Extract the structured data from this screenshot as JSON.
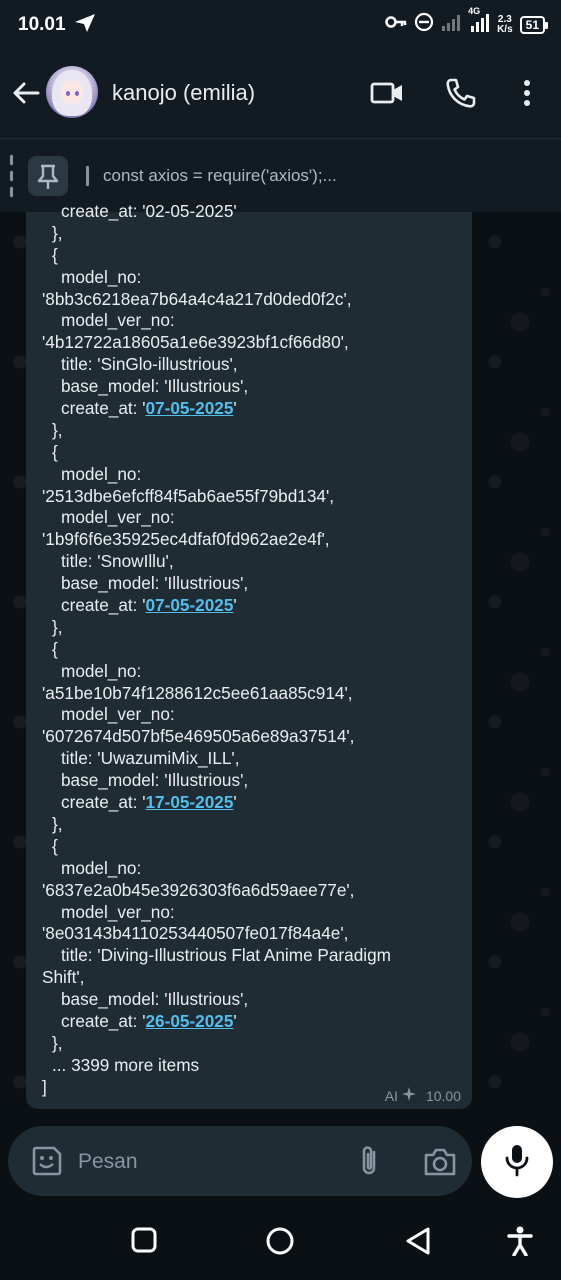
{
  "status_bar": {
    "time": "10.01",
    "network_type": "4G",
    "speed_value": "2.3",
    "speed_unit": "K/s",
    "battery": "51"
  },
  "header": {
    "contact_name": "kanojo (emilia)"
  },
  "pinned": {
    "preview": "const axios = require('axios');..."
  },
  "message": {
    "lines": [
      {
        "text": "create_at: '02-05-2025'",
        "indent": 2
      },
      {
        "text": "},",
        "indent": 1
      },
      {
        "text": "{",
        "indent": 1
      },
      {
        "text": "model_no:",
        "indent": 2
      },
      {
        "text": "'8bb3c6218ea7b64a4c4a217d0ded0f2c',",
        "indent": 0
      },
      {
        "text": "model_ver_no:",
        "indent": 2
      },
      {
        "text": "'4b12722a18605a1e6e3923bf1cf66d80',",
        "indent": 0
      },
      {
        "text": "title: 'SinGlo-illustrious',",
        "indent": 2
      },
      {
        "text": "base_model: 'Illustrious',",
        "indent": 2
      },
      {
        "text": "create_at: '",
        "date": "07-05-2025",
        "after": "'",
        "indent": 2
      },
      {
        "text": "},",
        "indent": 1
      },
      {
        "text": "{",
        "indent": 1
      },
      {
        "text": "model_no:",
        "indent": 2
      },
      {
        "text": "'2513dbe6efcff84f5ab6ae55f79bd134',",
        "indent": 0
      },
      {
        "text": "model_ver_no:",
        "indent": 2
      },
      {
        "text": "'1b9f6f6e35925ec4dfaf0fd962ae2e4f',",
        "indent": 0
      },
      {
        "text": "title: 'SnowIllu',",
        "indent": 2
      },
      {
        "text": "base_model: 'Illustrious',",
        "indent": 2
      },
      {
        "text": "create_at: '",
        "date": "07-05-2025",
        "after": "'",
        "indent": 2
      },
      {
        "text": "},",
        "indent": 1
      },
      {
        "text": "{",
        "indent": 1
      },
      {
        "text": "model_no:",
        "indent": 2
      },
      {
        "text": "'a51be10b74f1288612c5ee61aa85c914',",
        "indent": 0
      },
      {
        "text": "model_ver_no:",
        "indent": 2
      },
      {
        "text": "'6072674d507bf5e469505a6e89a37514',",
        "indent": 0
      },
      {
        "text": "title: 'UwazumiMix_ILL',",
        "indent": 2
      },
      {
        "text": "base_model: 'Illustrious',",
        "indent": 2
      },
      {
        "text": "create_at: '",
        "date": "17-05-2025",
        "after": "'",
        "indent": 2
      },
      {
        "text": "},",
        "indent": 1
      },
      {
        "text": "{",
        "indent": 1
      },
      {
        "text": "model_no:",
        "indent": 2
      },
      {
        "text": "'6837e2a0b45e3926303f6a6d59aee77e',",
        "indent": 0
      },
      {
        "text": "model_ver_no:",
        "indent": 2
      },
      {
        "text": "'8e03143b4110253440507fe017f84a4e',",
        "indent": 0
      },
      {
        "text": "title: 'Diving-Illustrious Flat Anime Paradigm",
        "indent": 2
      },
      {
        "text": "Shift',",
        "indent": 0
      },
      {
        "text": "base_model: 'Illustrious',",
        "indent": 2
      },
      {
        "text": "create_at: '",
        "date": "26-05-2025",
        "after": "'",
        "indent": 2
      },
      {
        "text": "},",
        "indent": 1
      },
      {
        "text": "... 3399 more items",
        "indent": 1
      },
      {
        "text": "]",
        "indent": 0
      }
    ],
    "ai_label": "AI",
    "time": "10.00"
  },
  "composer": {
    "placeholder": "Pesan"
  },
  "colors": {
    "background": "#0b1014",
    "bubble": "#1f2c34",
    "link": "#53bdeb",
    "text": "#e9edef",
    "muted": "#8696a0"
  },
  "icons": [
    "back-arrow-icon",
    "video-call-icon",
    "phone-icon",
    "more-vert-icon",
    "pin-icon",
    "sticker-icon",
    "attach-icon",
    "camera-icon",
    "mic-icon",
    "nav-recents-icon",
    "nav-home-icon",
    "nav-back-icon",
    "accessibility-icon"
  ]
}
